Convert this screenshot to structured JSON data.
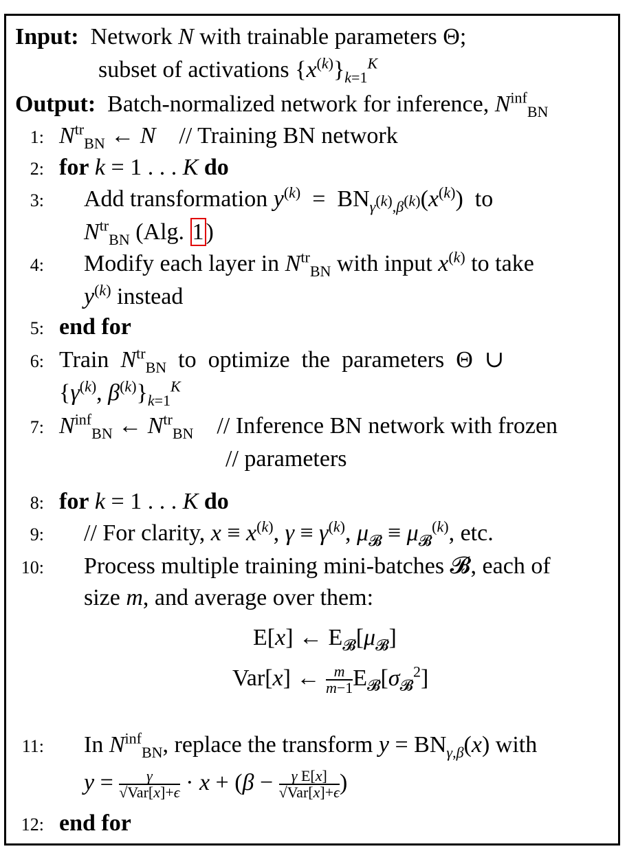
{
  "algorithm": {
    "input_label": "Input:",
    "input_line1": "Network N with trainable parameters Θ;",
    "input_line2": "subset of activations {x(k)} k=1..K",
    "output_label": "Output:",
    "output_text": "Batch-normalized network for inference, N_BN^inf",
    "steps": [
      {
        "n": "1:",
        "text": "N_BN^tr ← N    // Training BN network"
      },
      {
        "n": "2:",
        "text": "for k = 1 . . . K do"
      },
      {
        "n": "3:",
        "text": "Add transformation y(k) = BN_γ(k),β(k)(x(k)) to"
      },
      {
        "n": "",
        "text": "N_BN^tr (Alg. ",
        "ref": "1",
        "tail": ")"
      },
      {
        "n": "4:",
        "text": "Modify each layer in N_BN^tr with input x(k) to take"
      },
      {
        "n": "",
        "text": "y(k) instead"
      },
      {
        "n": "5:",
        "text": "end for"
      },
      {
        "n": "6:",
        "text": "Train  N_BN^tr  to  optimize  the  parameters  Θ ∪"
      },
      {
        "n": "",
        "text": "{γ(k), β(k)} k=1..K"
      },
      {
        "n": "7:",
        "text": "N_BN^inf ← N_BN^tr    // Inference BN network with frozen"
      },
      {
        "n": "",
        "text": "// parameters"
      },
      {
        "n": "8:",
        "text": "for k = 1 . . . K do"
      },
      {
        "n": "9:",
        "text": "// For clarity, x ≡ x(k), γ ≡ γ(k), μ_B ≡ μ_B(k), etc."
      },
      {
        "n": "10:",
        "text": "Process multiple training mini-batches B, each of"
      },
      {
        "n": "",
        "text": "size m, and average over them:"
      },
      {
        "n": "",
        "text": "E[x] ← E_B[μ_B]"
      },
      {
        "n": "",
        "text": "Var[x] ← m/(m−1) E_B[σ_B²]"
      },
      {
        "n": "11:",
        "text": "In N_BN^inf, replace the transform y = BN_γ,β(x) with"
      },
      {
        "n": "",
        "text": "y = γ/√(Var[x]+ε) · x + (β − γE[x]/√(Var[x]+ε))"
      },
      {
        "n": "12:",
        "text": "end for"
      }
    ],
    "ref_color": "#e00000"
  }
}
